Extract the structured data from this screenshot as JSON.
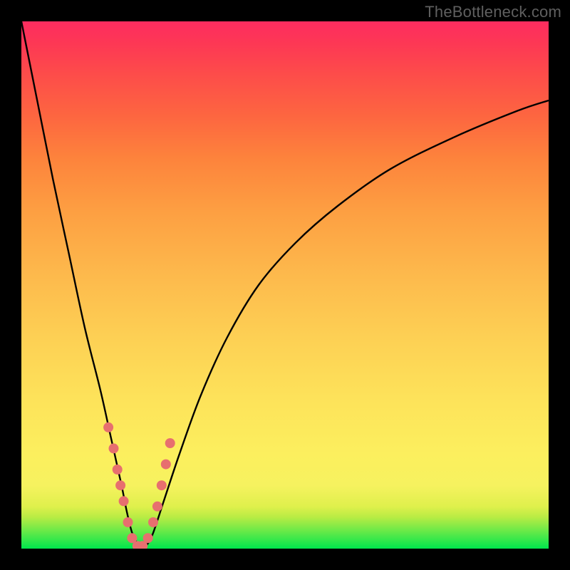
{
  "watermark": "TheBottleneck.com",
  "colors": {
    "frame": "#000000",
    "curve": "#000000",
    "markers": "#e76f6f",
    "gradient_stops": [
      "#00e64d",
      "#3fe84a",
      "#7dea47",
      "#b9ec44",
      "#dff04c",
      "#f6f25f",
      "#fcef5e",
      "#fde35a",
      "#fdd054",
      "#fdb94c",
      "#fd9f42",
      "#fd833c",
      "#fd6640",
      "#fd4c4a",
      "#fd3755",
      "#fd2c60"
    ]
  },
  "chart_data": {
    "type": "line",
    "title": "",
    "xlabel": "",
    "ylabel": "",
    "xlim": [
      0,
      100
    ],
    "ylim": [
      0,
      100
    ],
    "series": [
      {
        "name": "bottleneck-curve",
        "x": [
          0,
          3,
          6,
          9,
          12,
          15,
          17,
          19,
          20,
          21,
          22,
          23,
          24,
          25,
          27,
          30,
          34,
          39,
          45,
          52,
          60,
          70,
          82,
          94,
          100
        ],
        "y": [
          100,
          85,
          70,
          56,
          42,
          30,
          21,
          12,
          7,
          3,
          1,
          0,
          1,
          3,
          9,
          18,
          29,
          40,
          50,
          58,
          65,
          72,
          78,
          83,
          85
        ]
      }
    ],
    "markers": {
      "name": "highlighted-points",
      "x": [
        16.5,
        17.5,
        18.2,
        18.8,
        19.4,
        20.2,
        21.0,
        22.0,
        23.0,
        24.0,
        25.0,
        25.8,
        26.6,
        27.4,
        28.2
      ],
      "y": [
        23,
        19,
        15,
        12,
        9,
        5,
        2,
        0.5,
        0.5,
        2,
        5,
        8,
        12,
        16,
        20
      ]
    }
  }
}
